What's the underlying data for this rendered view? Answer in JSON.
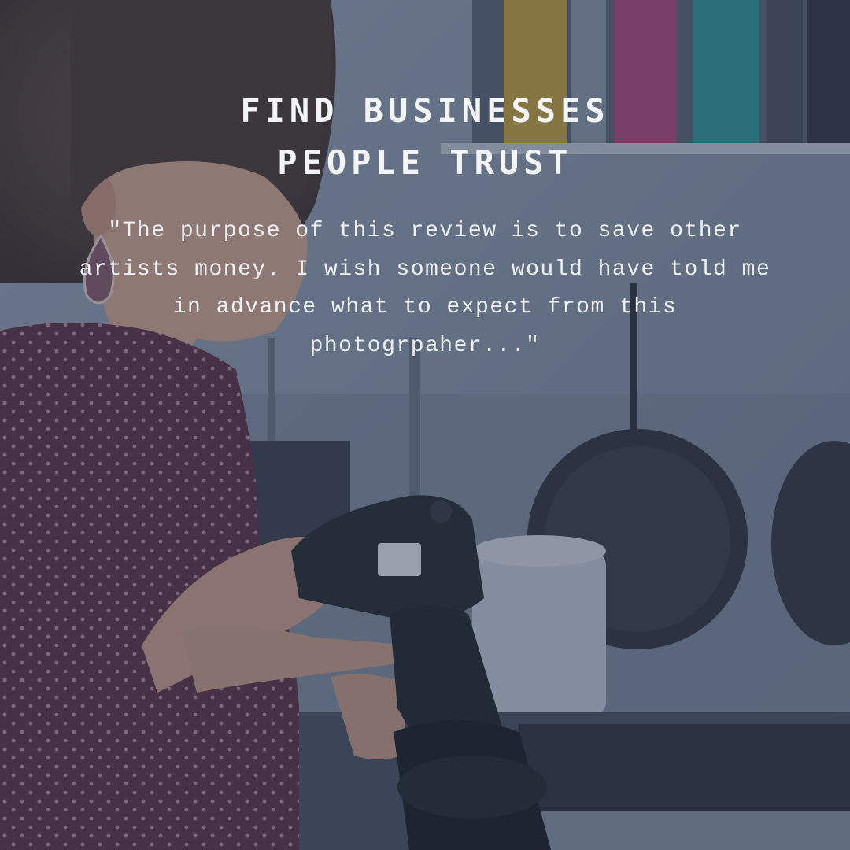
{
  "headline": {
    "line1": "FIND BUSINESSES",
    "line2": "PEOPLE TRUST"
  },
  "quote": "\"The purpose of this review is to save other artists money. I wish someone would have told me in advance what to expect from this photogrpaher...\"",
  "background": {
    "overlay_color": "#28344e",
    "scene": "photographer-holding-camera-in-kitchen"
  }
}
